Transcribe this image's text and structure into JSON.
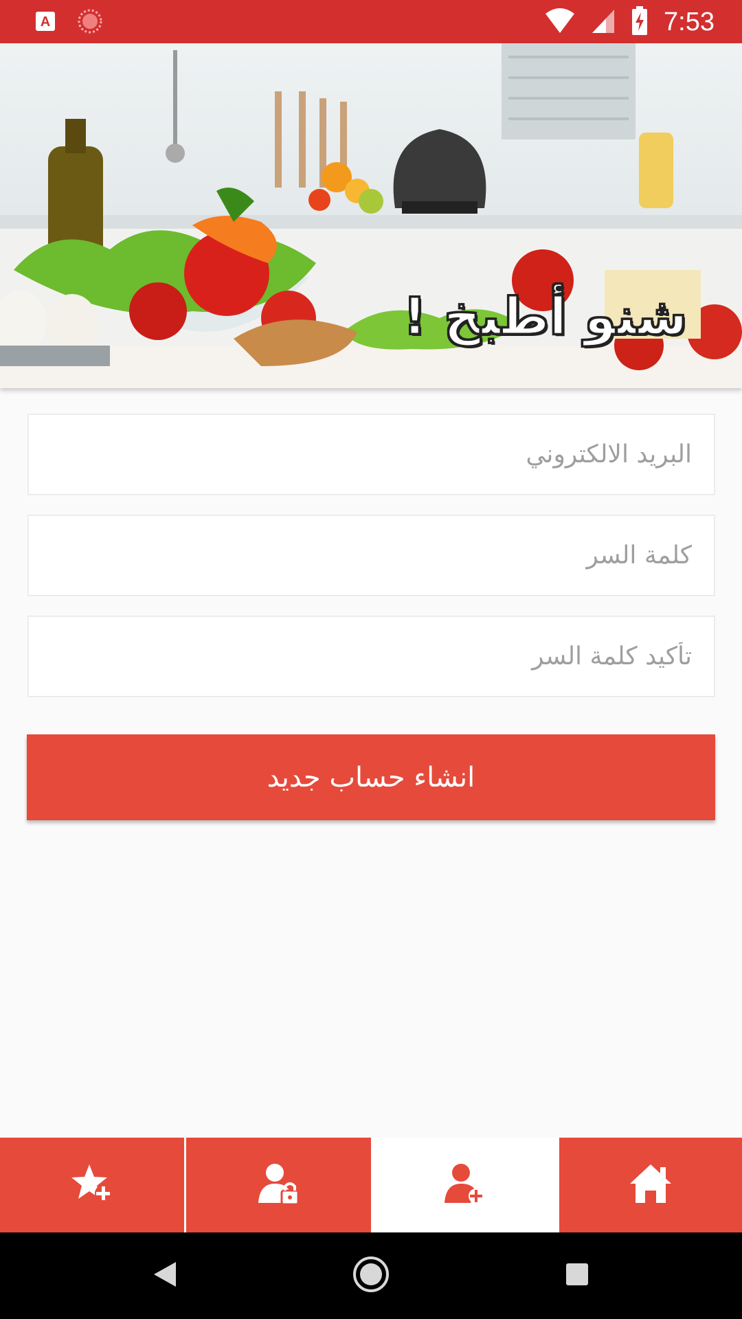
{
  "status_bar": {
    "time": "7:53",
    "icons": [
      "app-a-icon",
      "record-icon",
      "wifi-icon",
      "signal-icon",
      "battery-charging-icon"
    ]
  },
  "banner": {
    "title": "شنو أطبخ !",
    "description_image": "kitchen-vegetables-photo"
  },
  "form": {
    "email_placeholder": "البريد الالكتروني",
    "password_placeholder": "كلمة السر",
    "confirm_password_placeholder": "تأكيد كلمة السر",
    "submit_label": "انشاء حساب جديد"
  },
  "bottom_nav": {
    "items": [
      {
        "icon": "star-plus-icon",
        "active": false
      },
      {
        "icon": "user-lock-icon",
        "active": false
      },
      {
        "icon": "user-add-icon",
        "active": true
      },
      {
        "icon": "home-icon",
        "active": false
      }
    ]
  },
  "system_nav": {
    "buttons": [
      "back-icon",
      "home-circle-icon",
      "recents-icon"
    ]
  },
  "colors": {
    "status_bar": "#d32f2f",
    "primary": "#e64a3b",
    "background": "#fafafa",
    "field_bg": "#ffffff",
    "placeholder": "#9e9e9e"
  }
}
